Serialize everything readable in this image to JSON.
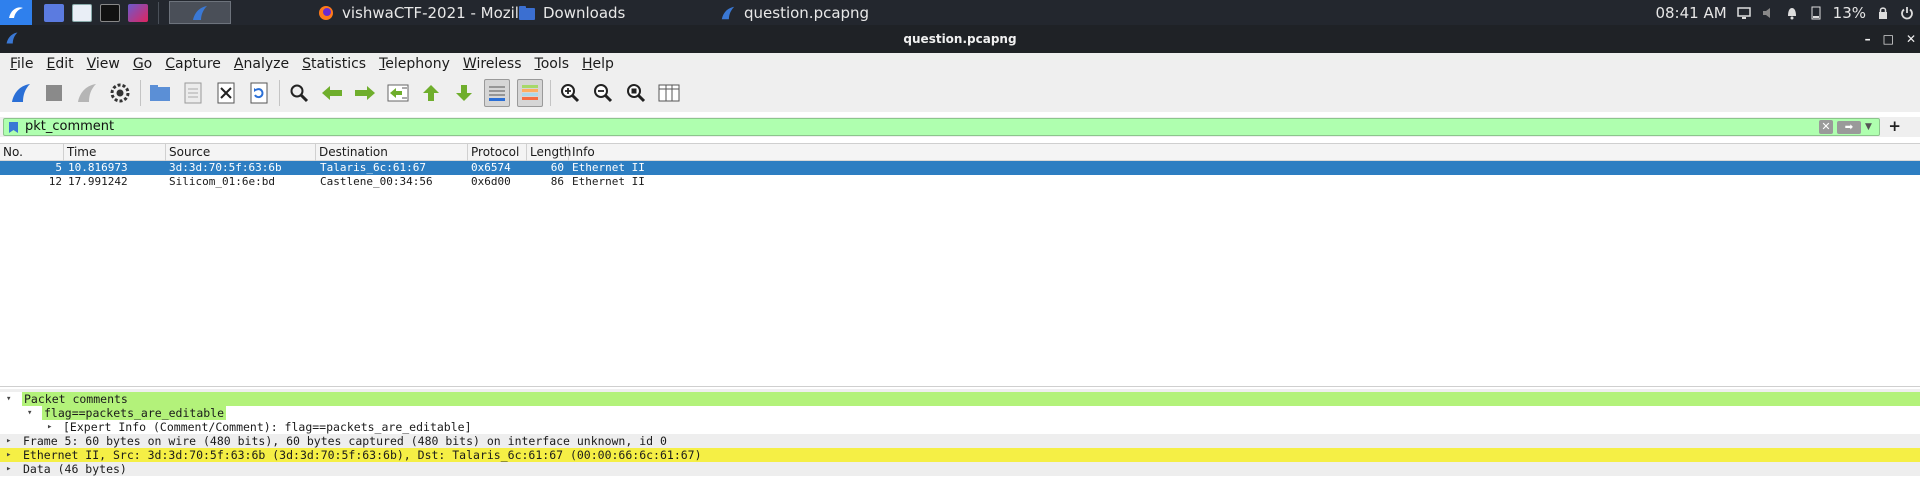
{
  "taskbar": {
    "tasks": [
      {
        "label": "vishwaCTF-2021 - Mozil...",
        "icon": "firefox-icon"
      },
      {
        "label": "Downloads",
        "icon": "folder-icon"
      },
      {
        "label": "question.pcapng",
        "icon": "wireshark-fin-icon"
      }
    ],
    "clock": "08:41 AM",
    "battery": "13%"
  },
  "window": {
    "title": "question.pcapng",
    "controls": [
      "–",
      "□",
      "✕"
    ]
  },
  "menu": [
    "File",
    "Edit",
    "View",
    "Go",
    "Capture",
    "Analyze",
    "Statistics",
    "Telephony",
    "Wireless",
    "Tools",
    "Help"
  ],
  "filter": {
    "value": "pkt_comment",
    "plus": "+"
  },
  "packet_list": {
    "columns": [
      "No.",
      "Time",
      "Source",
      "Destination",
      "Protocol",
      "Length",
      "Info"
    ],
    "rows": [
      {
        "no": "5",
        "time": "10.816973",
        "source": "3d:3d:70:5f:63:6b",
        "destination": "Talaris_6c:61:67",
        "protocol": "0x6574",
        "length": "60",
        "info": "Ethernet II",
        "selected": true
      },
      {
        "no": "12",
        "time": "17.991242",
        "source": "Silicom_01:6e:bd",
        "destination": "Castlene_00:34:56",
        "protocol": "0x6d00",
        "length": "86",
        "info": "Ethernet II",
        "selected": false
      }
    ]
  },
  "details": {
    "rows": [
      {
        "text": "Packet comments",
        "arrow": "▾"
      },
      {
        "text": "flag==packets_are_editable",
        "arrow": "▾"
      },
      {
        "text": "[Expert Info (Comment/Comment): flag==packets_are_editable]",
        "arrow": "▸"
      },
      {
        "text": "Frame 5: 60 bytes on wire (480 bits), 60 bytes captured (480 bits) on interface unknown, id 0",
        "arrow": "▸"
      },
      {
        "text": "Ethernet II, Src: 3d:3d:70:5f:63:6b (3d:3d:70:5f:63:6b), Dst: Talaris_6c:61:67 (00:00:66:6c:61:67)",
        "arrow": "▸"
      },
      {
        "text": "Data (46 bytes)",
        "arrow": "▸"
      }
    ]
  },
  "colors": {
    "selected_row": "#2d7ec2",
    "filter_ok": "#afffaf",
    "comment_green": "#b3f27a",
    "ethernet_yellow": "#f5ef45"
  }
}
